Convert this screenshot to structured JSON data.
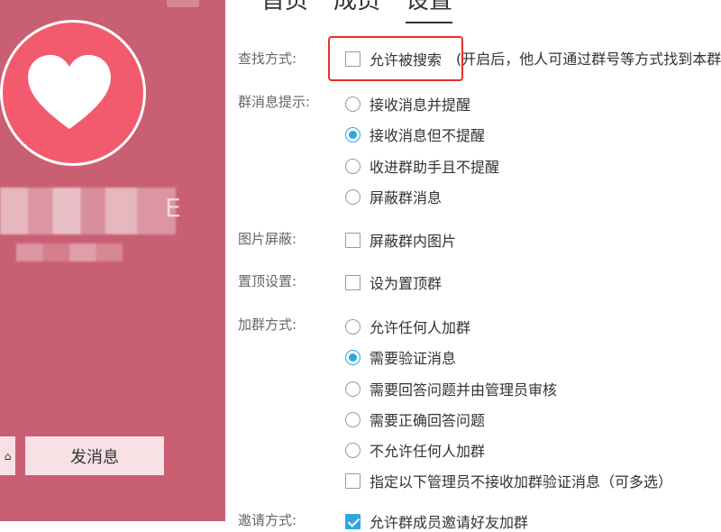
{
  "left_panel": {
    "name_tail": "E",
    "send_message_label": "发消息"
  },
  "tabs": [
    {
      "label": "首页"
    },
    {
      "label": "成员"
    },
    {
      "label": "设置"
    }
  ],
  "settings": {
    "search": {
      "label": "查找方式:",
      "option": "允许被搜索",
      "note": "(开启后，他人可通过群号等方式找到本群",
      "checked": false,
      "highlight_color": "#e8302c"
    },
    "notify": {
      "label": "群消息提示:",
      "options": [
        "接收消息并提醒",
        "接收消息但不提醒",
        "收进群助手且不提醒",
        "屏蔽群消息"
      ],
      "selected_index": 1
    },
    "image_block": {
      "label": "图片屏蔽:",
      "option": "屏蔽群内图片",
      "checked": false
    },
    "pin": {
      "label": "置顶设置:",
      "option": "设为置顶群",
      "checked": false
    },
    "join": {
      "label": "加群方式:",
      "options": [
        "允许任何人加群",
        "需要验证消息",
        "需要回答问题并由管理员审核",
        "需要正确回答问题",
        "不允许任何人加群"
      ],
      "selected_index": 1,
      "extra_checkbox": "指定以下管理员不接收加群验证消息（可多选）",
      "extra_checked": false
    },
    "invite": {
      "label": "邀请方式:",
      "option": "允许群成员邀请好友加群",
      "checked": true
    }
  },
  "colors": {
    "left_panel_bg": "#c95f72",
    "avatar_bg": "#f25a6e",
    "accent": "#2ea7e0"
  },
  "icons": {
    "avatar": "heart-icon"
  }
}
